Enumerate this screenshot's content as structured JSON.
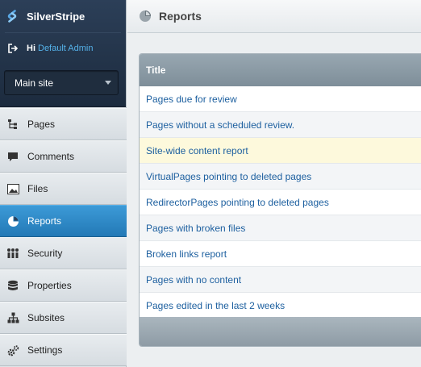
{
  "brand": {
    "name": "SilverStripe",
    "icon": "silverstripe-logo-icon"
  },
  "user": {
    "greeting": "Hi",
    "name": "Default Admin",
    "logout_icon": "logout-icon"
  },
  "site_selector": {
    "selected": "Main site"
  },
  "nav": [
    {
      "label": "Pages",
      "icon": "sitetree-icon",
      "active": false
    },
    {
      "label": "Comments",
      "icon": "comment-icon",
      "active": false
    },
    {
      "label": "Files",
      "icon": "image-icon",
      "active": false
    },
    {
      "label": "Reports",
      "icon": "pie-chart-icon",
      "active": true
    },
    {
      "label": "Security",
      "icon": "people-icon",
      "active": false
    },
    {
      "label": "Properties",
      "icon": "database-icon",
      "active": false
    },
    {
      "label": "Subsites",
      "icon": "hierarchy-icon",
      "active": false
    },
    {
      "label": "Settings",
      "icon": "gears-icon",
      "active": false
    }
  ],
  "header": {
    "title": "Reports",
    "icon": "pie-chart-icon"
  },
  "reports_table": {
    "column_title": "Title",
    "rows": [
      "Pages due for review",
      "Pages without a scheduled review.",
      "Site-wide content report",
      "VirtualPages pointing to deleted pages",
      "RedirectorPages pointing to deleted pages",
      "Pages with broken files",
      "Broken links report",
      "Pages with no content",
      "Pages edited in the last 2 weeks"
    ],
    "highlighted_row": 2
  },
  "colors": {
    "brand_dark": "#1c2b3e",
    "active_nav": "#2a86c4",
    "link": "#1c5f9f",
    "highlight": "#fdf9dc"
  }
}
